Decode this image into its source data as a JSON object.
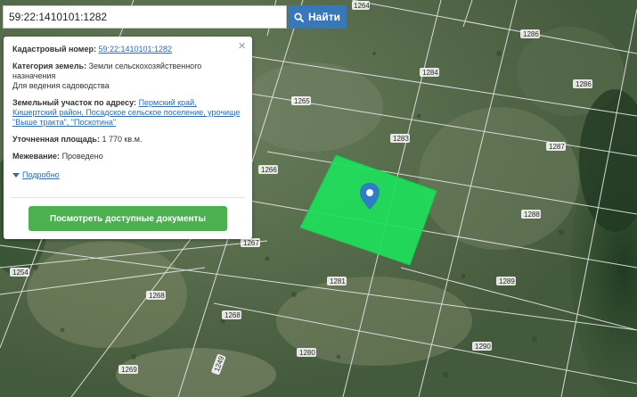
{
  "search": {
    "value": "59:22:1410101:1282",
    "button_label": "Найти",
    "icon": "search-icon"
  },
  "panel": {
    "close_label": "×",
    "cadastral": {
      "label": "Кадастровый номер:",
      "value": "59:22:1410101:1282"
    },
    "category": {
      "label": "Категория земель:",
      "value": "Земли сельскохозяйственного назначения",
      "use": "Для ведения садоводства"
    },
    "address": {
      "label": "Земельный участок по адресу:",
      "value": "Пермский край, Кишертский район, Посадское сельское поселение, урочище \"Выше тракта\", \"Поскотина\""
    },
    "area": {
      "label": "Уточненная площадь:",
      "value": "1 770 кв.м."
    },
    "survey": {
      "label": "Межевание:",
      "value": "Проведено"
    },
    "more_label": "Подробно",
    "docs_button": "Посмотреть доступные документы"
  },
  "colors": {
    "accent": "#3a77b8",
    "parcel_highlight": "#1de05a",
    "button_green": "#4caf50",
    "marker": "#2f7dc4"
  },
  "map": {
    "parcel_labels": [
      "1264",
      "1286",
      "1284",
      "1286",
      "1265",
      "1283",
      "1287",
      "1266",
      "1288",
      "1267",
      "1254",
      "1281",
      "1289",
      "1268",
      "1268",
      "1280",
      "1290",
      "1269",
      "1249"
    ]
  }
}
